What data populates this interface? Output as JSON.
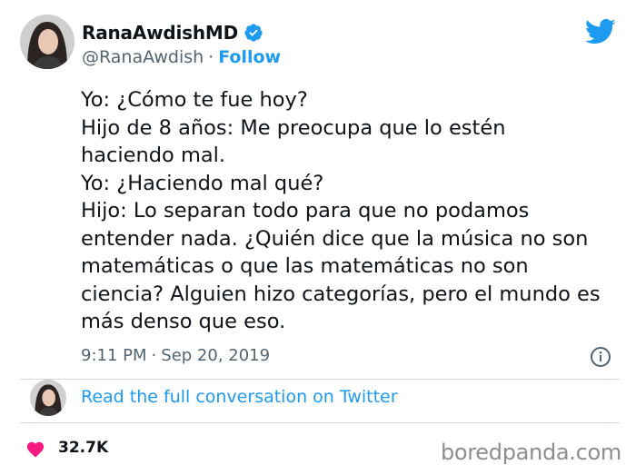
{
  "header": {
    "display_name": "RanaAwdishMD",
    "handle": "@RanaAwdish",
    "separator": "·",
    "follow_label": "Follow"
  },
  "tweet": {
    "text": "Yo: ¿Cómo te fue hoy?\nHijo de 8 años: Me preocupa que lo estén\nhaciendo mal.\nYo: ¿Haciendo mal qué?\nHijo: Lo separan todo para que no podamos\nentender nada. ¿Quién dice que la música no son\nmatemáticas o que las matemáticas no son\nciencia? Alguien hizo categorías, pero el mundo es\nmás denso que eso.",
    "time": "9:11 PM",
    "separator": "·",
    "date": "Sep 20, 2019"
  },
  "conversation": {
    "link_label": "Read the full conversation on Twitter"
  },
  "footer": {
    "likes": "32.7K",
    "watermark": "boredpanda.com"
  },
  "colors": {
    "accent": "#1d9bf0",
    "heart": "#f91880",
    "secondary_text": "#536471"
  },
  "icons": [
    "avatar-photo",
    "verified-badge-icon",
    "twitter-bird-icon",
    "info-icon",
    "heart-icon"
  ]
}
